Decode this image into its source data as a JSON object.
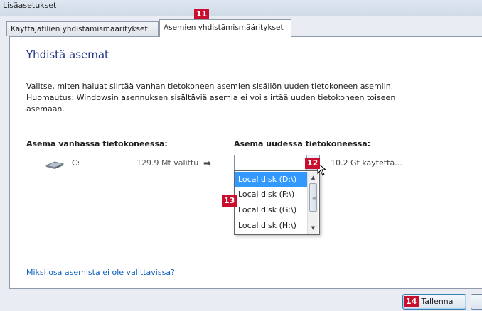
{
  "window": {
    "title": "Lisäasetukset"
  },
  "tabs": [
    {
      "label": "Käyttäjätilien yhdistämismääritykset"
    },
    {
      "label": "Asemien yhdistämismääritykset"
    }
  ],
  "callouts": {
    "c11": "11",
    "c12": "12",
    "c13": "13",
    "c14": "14"
  },
  "content": {
    "heading": "Yhdistä asemat",
    "description": "Valitse, miten haluat siirtää vanhan tietokoneen asemien sisällön uuden tietokoneen asemiin. Huomautus: Windowsin asennuksen sisältäviä asemia ei voi siirtää uuden tietokoneen toiseen asemaan.",
    "old_drive_header": "Asema vanhassa tietokoneessa:",
    "new_drive_header": "Asema uudessa tietokoneessa:",
    "drive": {
      "letter": "C:",
      "size_selected": "129.9 Mt valittu",
      "used": "10.2 Gt käytettä..."
    },
    "target_select": {
      "value": ""
    },
    "dropdown_options": [
      {
        "label": "Local disk (D:\\)"
      },
      {
        "label": "Local disk (F:\\)"
      },
      {
        "label": "Local disk (G:\\)"
      },
      {
        "label": "Local disk (H:\\)"
      }
    ],
    "help_link": "Miksi osa asemista ei ole valittavissa?"
  },
  "buttons": {
    "save": "Tallenna"
  },
  "colors": {
    "accent": "#1e3287",
    "link": "#0a5ebd",
    "callout": "#c8102e",
    "selection": "#3399ff"
  }
}
